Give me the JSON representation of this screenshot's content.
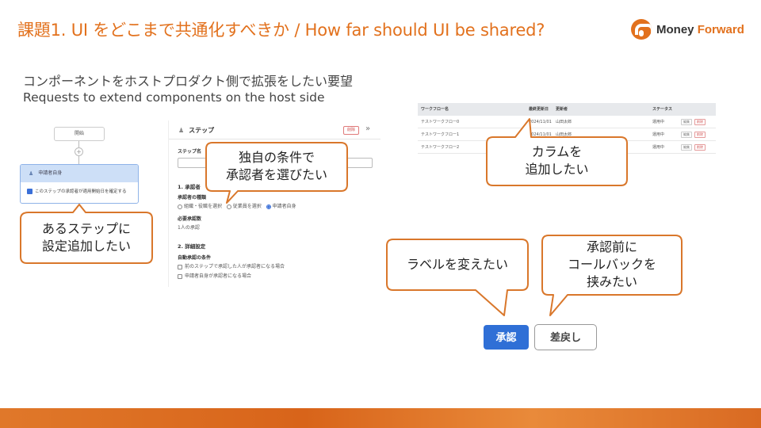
{
  "header": {
    "title": "課題1. UI をどこまで共通化すべきか / How far should UI be shared?",
    "logo_text_1": "Money ",
    "logo_text_2": "Forward"
  },
  "subtitle": {
    "ja": "コンポーネントをホストプロダクト側で拡張をしたい要望",
    "en": "Requests to extend components on the host side"
  },
  "flow": {
    "start_label": "開始",
    "plus": "+",
    "node_title": "申請者自身",
    "node_option": "このステップの承認者が適用開始日を確定する"
  },
  "step_panel": {
    "title": "ステップ",
    "delete_label": "削除",
    "step_name_label": "ステップ名",
    "section1": "1. 承認者",
    "approver_type_label": "承認者の種類",
    "radio_options": [
      "組織・役職を選択",
      "従業員を選択",
      "申請者自身"
    ],
    "required_count_label": "必要承認数",
    "required_count_value": "1人の承認",
    "section2": "2. 詳細設定",
    "auto_approve_label": "自動承認の条件",
    "auto_options": [
      "前のステップで承認した人が承認者になる場合",
      "申請者自身が承認者になる場合"
    ]
  },
  "table": {
    "headers": [
      "ワークフロー名",
      "最終更新日",
      "更新者",
      "ステータス"
    ],
    "rows": [
      {
        "name": "テストワークフロー0",
        "date": "2024/11/01",
        "user": "山田太郎",
        "status": "運用中"
      },
      {
        "name": "テストワークフロー1",
        "date": "2024/11/01",
        "user": "山田太郎",
        "status": "運用中"
      },
      {
        "name": "テストワークフロー2",
        "date": "",
        "user": "",
        "status": "運用中"
      }
    ],
    "edit_label": "編集",
    "delete_label": "削除"
  },
  "buttons": {
    "approve": "承認",
    "return": "差戻し"
  },
  "callouts": {
    "step_setting": [
      "あるステップに",
      "設定追加したい"
    ],
    "approver_condition": [
      "独自の条件で",
      "承認者を選びたい"
    ],
    "add_column": [
      "カラムを",
      "追加したい"
    ],
    "change_label": [
      "ラベルを変えたい"
    ],
    "callback": [
      "承認前に",
      "コールバックを",
      "挟みたい"
    ]
  },
  "colors": {
    "accent": "#e2711d",
    "callout_border": "#d9772b",
    "primary_button": "#2f6fd6"
  }
}
